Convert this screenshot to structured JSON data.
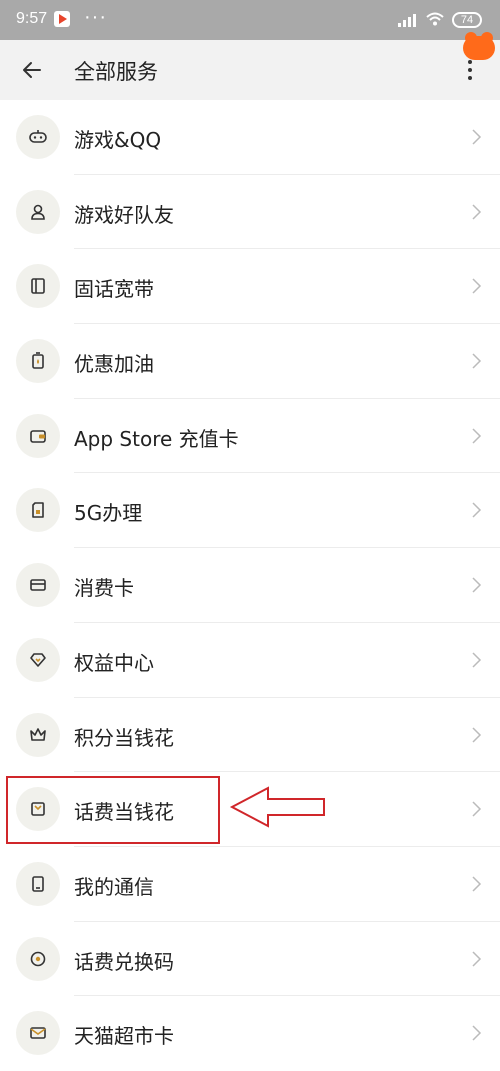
{
  "status_bar": {
    "time": "9:57",
    "dots": "···",
    "battery": "74"
  },
  "header": {
    "back_icon": "arrow-left-icon",
    "title": "全部服务",
    "more_icon": "more-vertical-icon"
  },
  "services": [
    {
      "label": "游戏&QQ",
      "icon": "gamepad-icon"
    },
    {
      "label": "游戏好队友",
      "icon": "person-icon"
    },
    {
      "label": "固话宽带",
      "icon": "book-icon"
    },
    {
      "label": "优惠加油",
      "icon": "fuel-icon"
    },
    {
      "label": "App Store 充值卡",
      "icon": "wallet-icon"
    },
    {
      "label": "5G办理",
      "icon": "sim-card-icon"
    },
    {
      "label": "消费卡",
      "icon": "card-icon"
    },
    {
      "label": "权益中心",
      "icon": "diamond-icon"
    },
    {
      "label": "积分当钱花",
      "icon": "crown-icon"
    },
    {
      "label": "话费当钱花",
      "icon": "envelope-icon"
    },
    {
      "label": "我的通信",
      "icon": "phone-icon"
    },
    {
      "label": "话费兑换码",
      "icon": "target-icon"
    },
    {
      "label": "天猫超市卡",
      "icon": "mail-icon"
    }
  ],
  "colors": {
    "accent_icon": "#c8902a",
    "highlight": "#d0262a",
    "badge": "#ff6a1a"
  }
}
